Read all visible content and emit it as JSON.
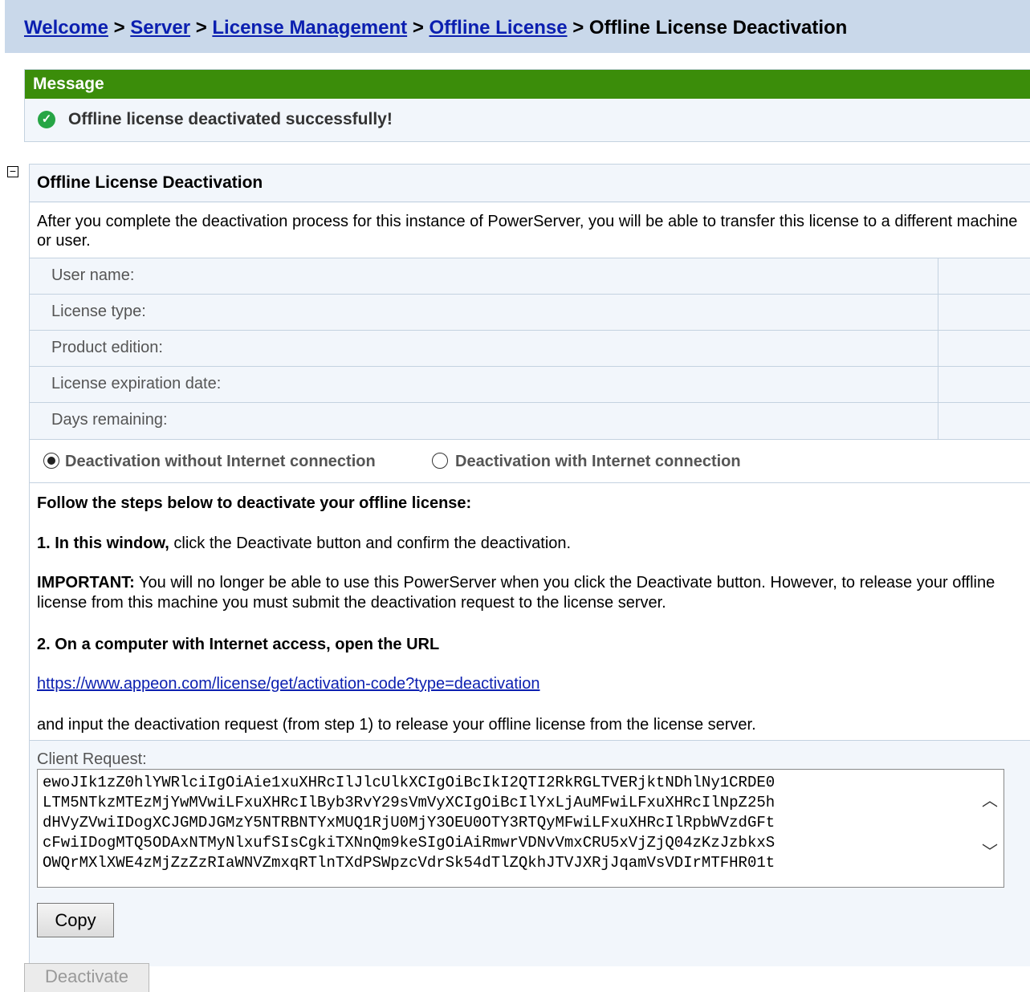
{
  "breadcrumb": {
    "items": [
      "Welcome",
      "Server",
      "License Management",
      "Offline License"
    ],
    "separator": ">",
    "current": "Offline License Deactivation"
  },
  "message": {
    "header": "Message",
    "text": "Offline license deactivated successfully!",
    "icon": "check-circle-icon"
  },
  "panel": {
    "title": "Offline License Deactivation",
    "intro": "After you complete the deactivation process for this instance of PowerServer, you will be able to transfer this license to a different machine or user.",
    "fields": [
      {
        "label": "User name:",
        "value": ""
      },
      {
        "label": "License type:",
        "value": ""
      },
      {
        "label": "Product edition:",
        "value": ""
      },
      {
        "label": "License expiration date:",
        "value": ""
      },
      {
        "label": "Days remaining:",
        "value": ""
      }
    ],
    "radios": [
      {
        "label": "Deactivation without Internet connection",
        "selected": true
      },
      {
        "label": "Deactivation with Internet connection",
        "selected": false
      }
    ]
  },
  "steps": {
    "heading": "Follow the steps below to deactivate your offline license:",
    "step1_bold": "1. In this window,",
    "step1_text": " click the Deactivate button and confirm the deactivation.",
    "important_bold": "IMPORTANT:",
    "important_text": " You will no longer be able to use this PowerServer when you click the Deactivate button. However, to release your offline license from this machine you must submit the deactivation request to the license server.",
    "step2": "2. On a computer with Internet access, open the URL",
    "url": "https://www.appeon.com/license/get/activation-code?type=deactivation",
    "after_url": "and input the deactivation request (from step 1) to release your offline license from the license server."
  },
  "client_request": {
    "label": "Client Request:",
    "text": "ewoJIk1zZ0hlYWRlciIgOiAie1xuXHRcIlJlcUlkXCIgOiBcIkI2QTI2RkRGLTVERjktNDhlNy1CRDE0\nLTM5NTkzMTEzMjYwMVwiLFxuXHRcIlByb3RvY29sVmVyXCIgOiBcIlYxLjAuMFwiLFxuXHRcIlNpZ25h\ndHVyZVwiIDogXCJGMDJGMzY5NTRBNTYxMUQ1RjU0MjY3OEU0OTY3RTQyMFwiLFxuXHRcIlRpbWVzdGFt\ncFwiIDogMTQ5ODAxNTMyNlxufSIsCgkiTXNnQm9keSIgOiAiRmwrVDNvVmxCRU5xVjZjQ04zKzJzbkxS\nOWQrMXlXWE4zMjZzZzRIaWNVZmxqRTlnTXdPSWpzcVdrSk54dTlZQkhJTVJXRjJqamVsVDIrMTFHR01t"
  },
  "buttons": {
    "copy": "Copy",
    "deactivate": "Deactivate"
  }
}
